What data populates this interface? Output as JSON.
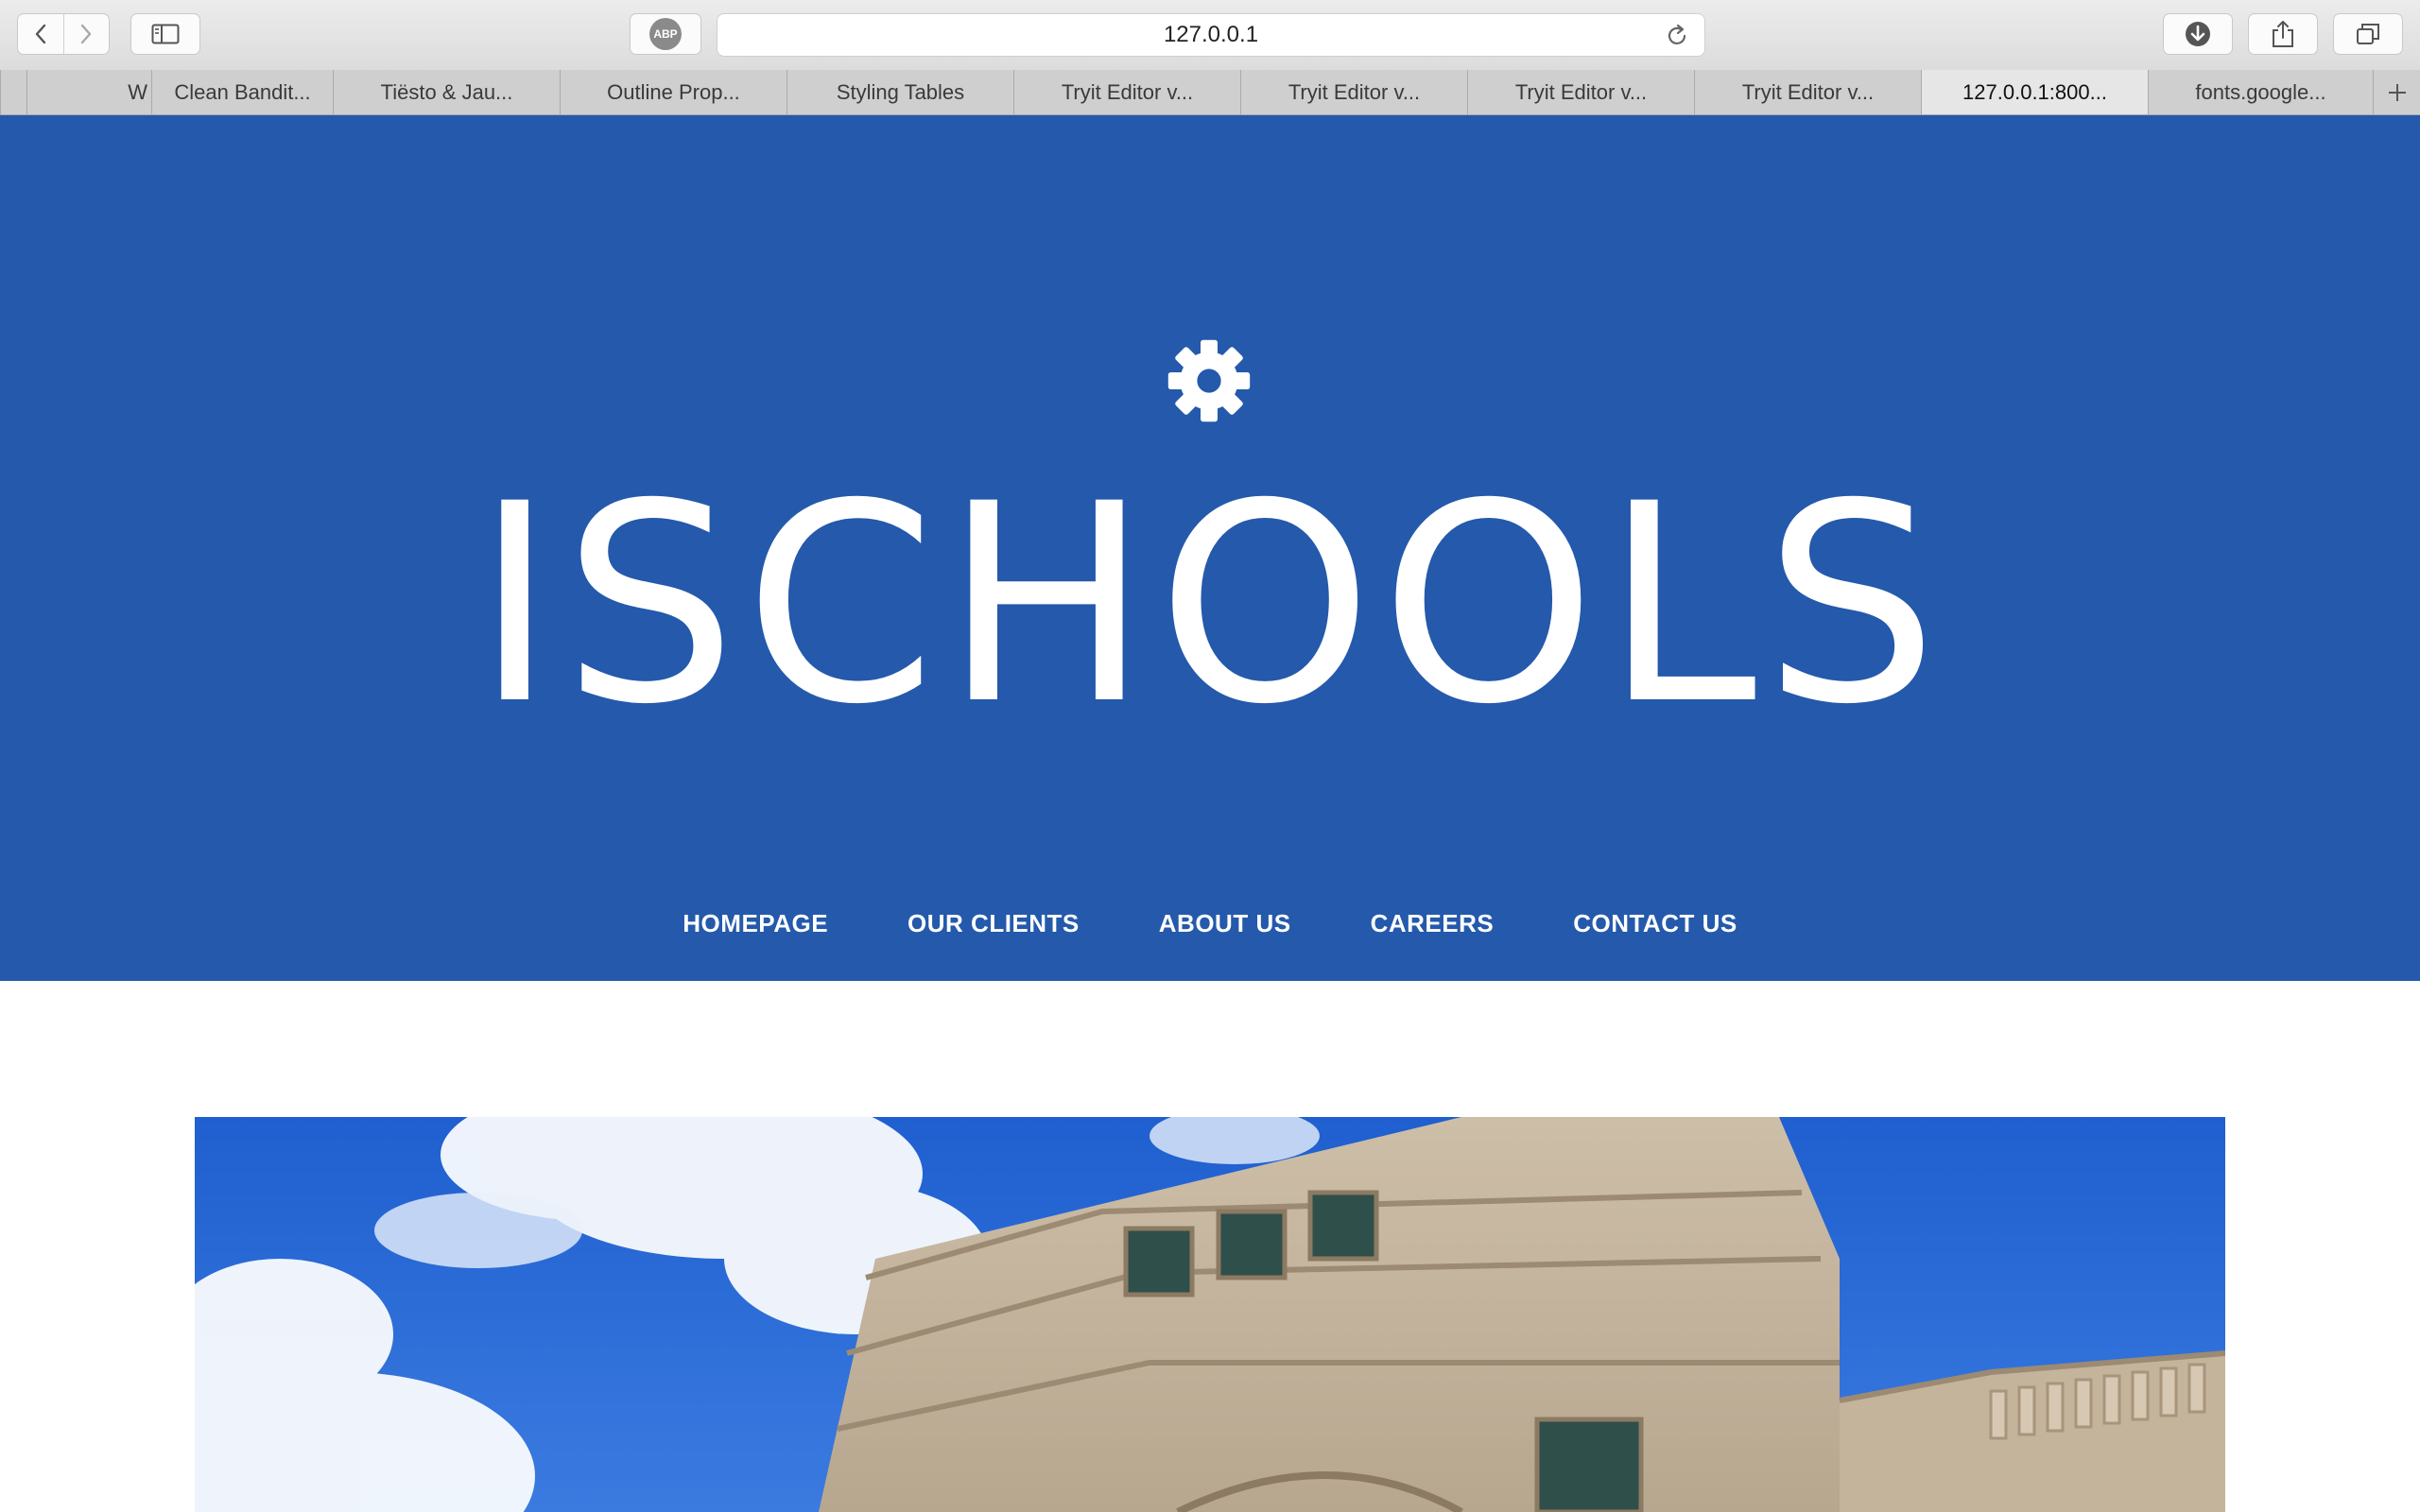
{
  "browser": {
    "url": "127.0.0.1",
    "adblock_label": "ABP",
    "tabs": [
      {
        "label": "W",
        "active": false
      },
      {
        "label": "Clean Bandit...",
        "active": false
      },
      {
        "label": "Tiësto & Jau...",
        "active": false
      },
      {
        "label": "Outline Prop...",
        "active": false
      },
      {
        "label": "Styling Tables",
        "active": false
      },
      {
        "label": "Tryit Editor v...",
        "active": false
      },
      {
        "label": "Tryit Editor v...",
        "active": false
      },
      {
        "label": "Tryit Editor v...",
        "active": false
      },
      {
        "label": "Tryit Editor v...",
        "active": false
      },
      {
        "label": "127.0.0.1:800...",
        "active": true
      },
      {
        "label": "fonts.google...",
        "active": false
      }
    ],
    "icons": [
      "back-icon",
      "forward-icon",
      "sidebar-icon",
      "reload-icon",
      "download-icon",
      "share-icon",
      "tabs-overview-icon",
      "new-tab-icon"
    ]
  },
  "site": {
    "logo_icon": "gear-icon",
    "brand": "ISCHOOLS",
    "nav": [
      "HOMEPAGE",
      "OUR CLIENTS",
      "ABOUT US",
      "CAREERS",
      "CONTACT US"
    ],
    "hero_color": "#2459ac",
    "hero_image": "school building against blue sky"
  }
}
